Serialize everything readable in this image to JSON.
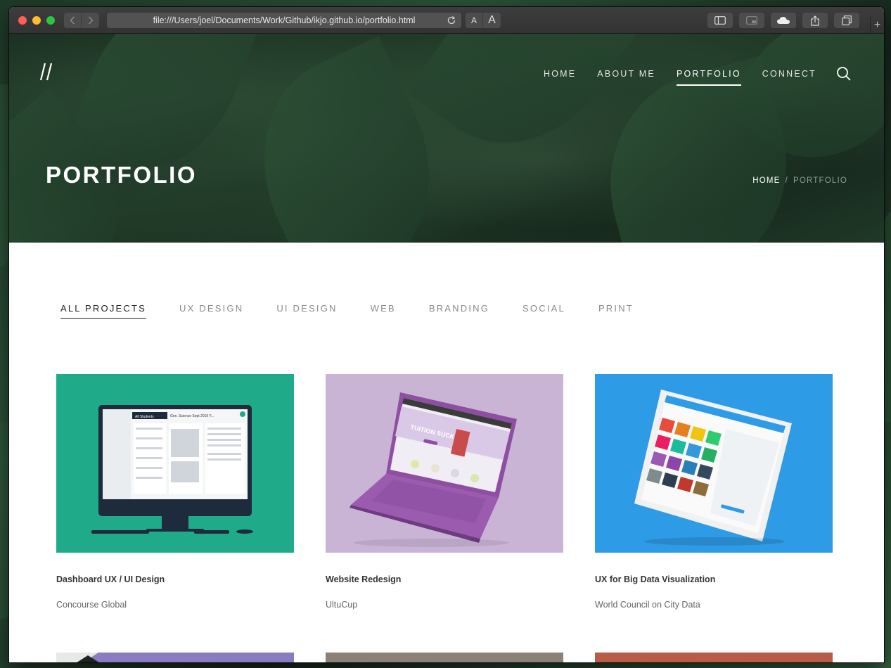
{
  "browser": {
    "url": "file:///Users/joel/Documents/Work/Github/ikjo.github.io/portfolio.html",
    "font_small": "A",
    "font_large": "A"
  },
  "site": {
    "logo": "//",
    "nav": [
      {
        "label": "HOME"
      },
      {
        "label": "ABOUT ME"
      },
      {
        "label": "PORTFOLIO",
        "active": true
      },
      {
        "label": "CONNECT"
      }
    ],
    "page_title": "PORTFOLIO",
    "breadcrumb": {
      "home": "HOME",
      "separator": "/",
      "current": "PORTFOLIO"
    }
  },
  "filters": [
    {
      "label": "ALL PROJECTS",
      "active": true
    },
    {
      "label": "UX DESIGN"
    },
    {
      "label": "UI DESIGN"
    },
    {
      "label": "WEB"
    },
    {
      "label": "BRANDING"
    },
    {
      "label": "SOCIAL"
    },
    {
      "label": "PRINT"
    }
  ],
  "projects": [
    {
      "title": "Dashboard UX / UI Design",
      "client": "Concourse Global",
      "color": "#1fab8a"
    },
    {
      "title": "Website Redesign",
      "client": "UltuCup",
      "color": "#c9b4d6"
    },
    {
      "title": "UX for Big Data Visualization",
      "client": "World Council on City Data",
      "color": "#2e9be6"
    }
  ],
  "mockups": {
    "dashboard_header": "All Students",
    "dashboard_panel": "Gen. Science Sept 2019 F...",
    "website_headline": "TUITION SUCKS!"
  },
  "row2_colors": [
    "#8b7bc2",
    "#8c8176",
    "#b85c47"
  ],
  "colors": {
    "accent": "#ffffff",
    "text_dark": "#222222",
    "text_muted": "#8a8a8a"
  }
}
